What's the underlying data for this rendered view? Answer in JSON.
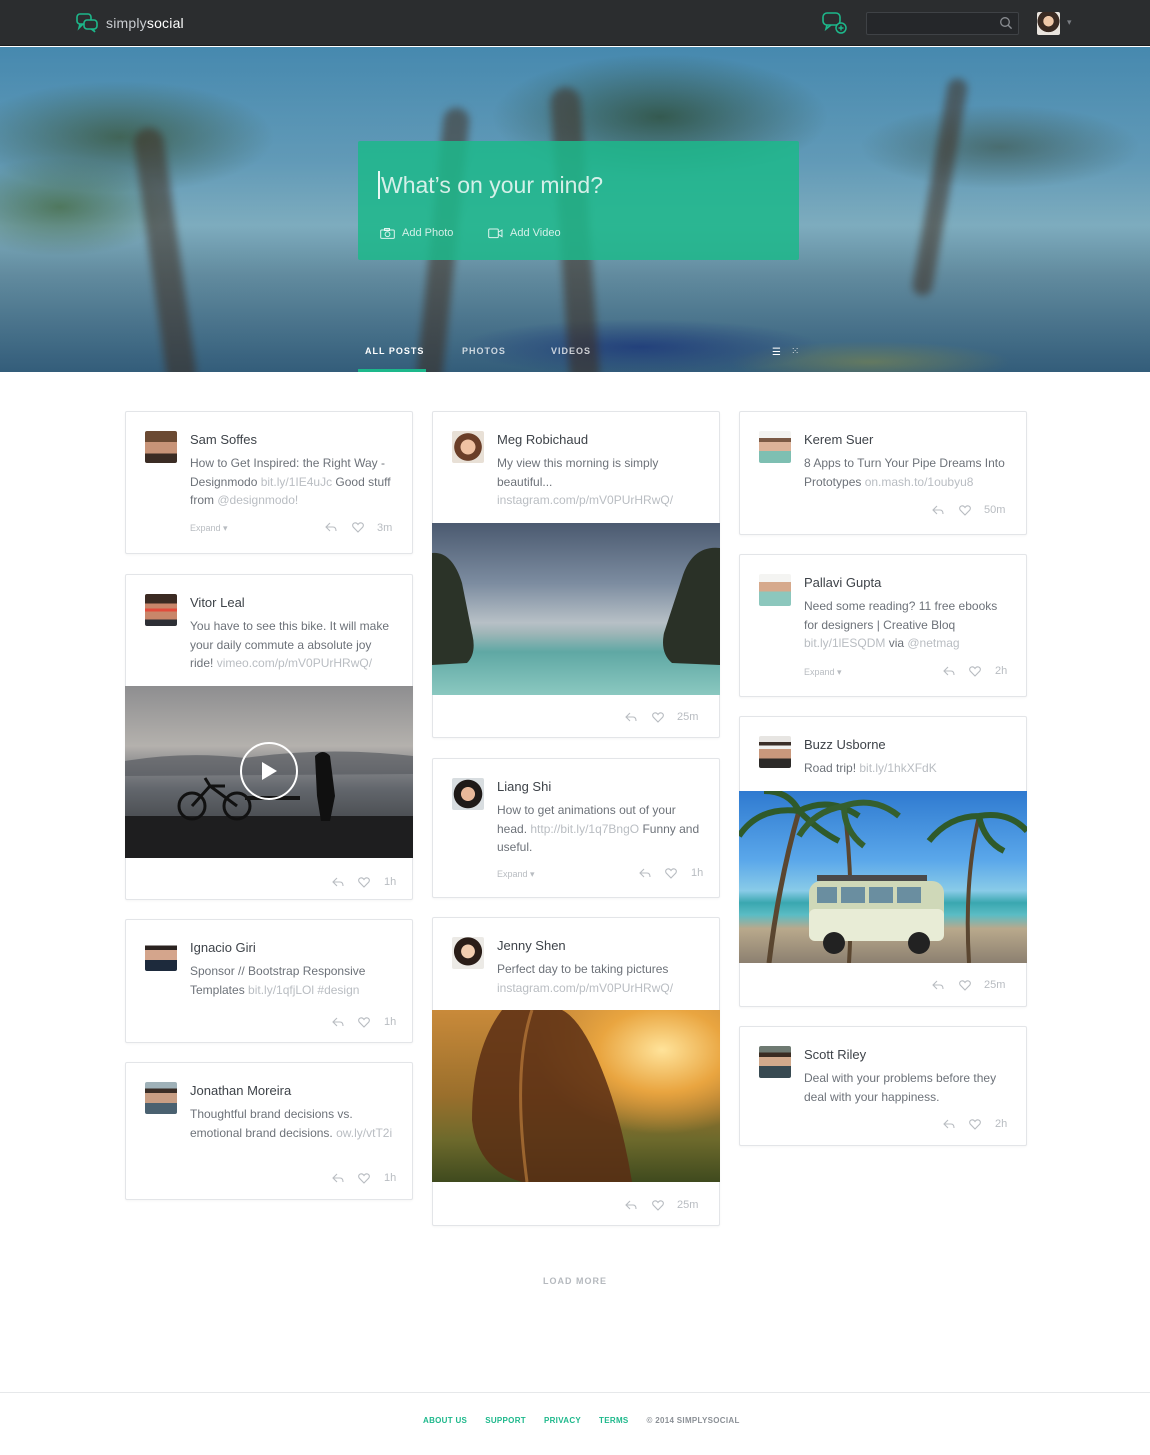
{
  "brand": {
    "prefix": "simply",
    "suffix": "social"
  },
  "header": {
    "search_placeholder": ""
  },
  "composer": {
    "placeholder": "What’s on your mind?",
    "add_photo": "Add Photo",
    "add_video": "Add Video"
  },
  "tabs": [
    {
      "label": "ALL POSTS"
    },
    {
      "label": "PHOTOS"
    },
    {
      "label": "VIDEOS"
    }
  ],
  "colors": {
    "accent": "#1db88b",
    "navbar": "#2b2d2f",
    "muted": "#b8bcc1"
  },
  "posts": [
    {
      "author": "Sam Soffes",
      "text": "How to Get Inspired: the Right Way - Designmodo ",
      "link": "bit.ly/1IE4uJc",
      "text2": " Good stuff from ",
      "link2": "@designmodo!",
      "expand": "Expand",
      "time": "3m"
    },
    {
      "author": "Vitor Leal",
      "text": "You have to see this bike. It will make your daily commute a absolute joy ride! ",
      "link": "vimeo.com/p/mV0PUrHRwQ/",
      "time": "1h"
    },
    {
      "author": "Ignacio Giri",
      "text": "Sponsor // Bootstrap Responsive Templates ",
      "link": "bit.ly/1qfjLOl #design",
      "time": "1h"
    },
    {
      "author": "Jonathan Moreira",
      "text": "Thoughtful brand decisions vs. emotional brand decisions. ",
      "link": "ow.ly/vtT2i",
      "time": "1h"
    },
    {
      "author": "Meg Robichaud",
      "text": "My view this morning is simply beautiful... ",
      "link": "instagram.com/p/mV0PUrHRwQ/",
      "time": "25m"
    },
    {
      "author": "Liang Shi",
      "text": "How to get animations out of your head. ",
      "link": "http://bit.ly/1q7BngO",
      "text2": "  Funny and useful.",
      "expand": "Expand",
      "time": "1h"
    },
    {
      "author": "Jenny Shen",
      "text": "Perfect day to be taking pictures ",
      "link": "instagram.com/p/mV0PUrHRwQ/",
      "time": "25m"
    },
    {
      "author": "Kerem Suer",
      "text": "8 Apps to Turn Your Pipe Dreams Into Prototypes ",
      "link": "on.mash.to/1oubyu8",
      "time": "50m"
    },
    {
      "author": "Pallavi Gupta",
      "text": "Need some reading? 11 free ebooks for designers | Creative Bloq ",
      "link": "bit.ly/1lESQDM",
      "text2": " via ",
      "link2": "@netmag",
      "expand": "Expand",
      "time": "2h"
    },
    {
      "author": "Buzz Usborne",
      "text": "Road trip!  ",
      "link": "bit.ly/1hkXFdK",
      "time": "25m"
    },
    {
      "author": "Scott Riley",
      "text": "Deal with your problems before they deal with your happiness.",
      "time": "2h"
    }
  ],
  "load_more": "LOAD MORE",
  "footer": {
    "about": "ABOUT US",
    "support": "SUPPORT",
    "privacy": "PRIVACY",
    "terms": "TERMS",
    "copyright": "© 2014 SIMPLYSOCIAL"
  }
}
